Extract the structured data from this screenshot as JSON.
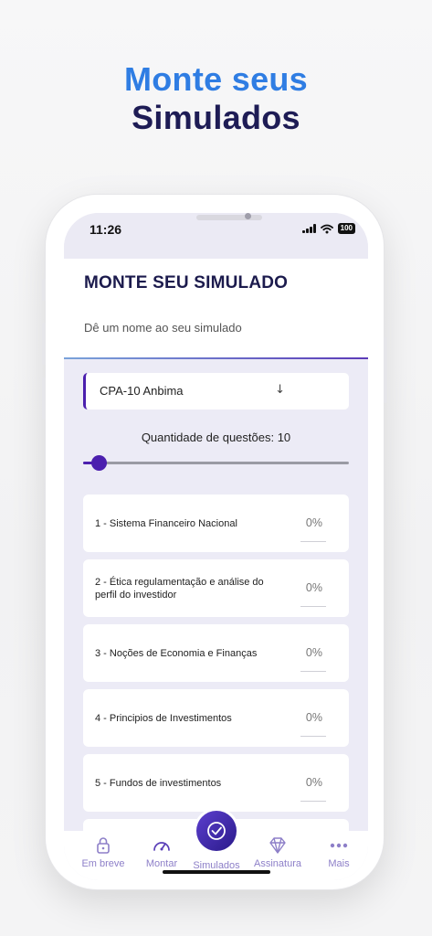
{
  "headline": {
    "line1": "Monte seus",
    "line2": "Simulados"
  },
  "status_bar": {
    "time": "11:26",
    "battery": "100"
  },
  "page": {
    "title": "MONTE SEU SIMULADO",
    "name_placeholder": "Dê um nome ao seu simulado",
    "exam_select": {
      "value": "CPA-10 Anbima",
      "arrow": "↓"
    },
    "question_count_label": "Quantidade de questões: 10",
    "question_count_slider": {
      "value": 10,
      "fill_fraction": 0.06
    }
  },
  "topics": [
    {
      "label": "1 - Sistema Financeiro Nacional",
      "percent": "0%"
    },
    {
      "label": "2 - Ética regulamentação e análise do perfil do investidor",
      "percent": "0%"
    },
    {
      "label": "3 - Noções de Economia e Finanças",
      "percent": "0%"
    },
    {
      "label": "4 - Principios de Investimentos",
      "percent": "0%"
    },
    {
      "label": "5 - Fundos de investimentos",
      "percent": "0%"
    }
  ],
  "tabbar": {
    "items": [
      {
        "label": "Em breve",
        "icon": "lock-icon"
      },
      {
        "label": "Montar",
        "icon": "speedometer-icon"
      },
      {
        "label": "Simulados",
        "icon": "check-circle-icon"
      },
      {
        "label": "Assinatura",
        "icon": "diamond-icon"
      },
      {
        "label": "Mais",
        "icon": "more-dots-icon"
      }
    ]
  },
  "colors": {
    "accent": "#4b1fae",
    "headline_blue": "#2f7de3",
    "headline_navy": "#1e1c55",
    "tab_inactive": "#8d7fc8"
  }
}
